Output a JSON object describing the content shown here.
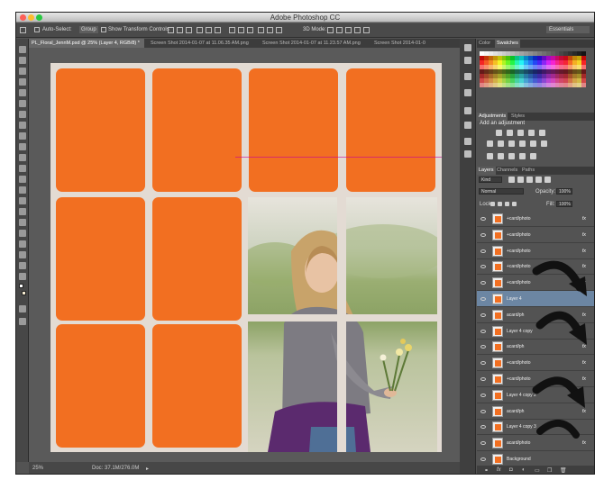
{
  "window": {
    "title": "Adobe Photoshop CC"
  },
  "options": {
    "auto_select_label": "Auto-Select:",
    "auto_select_value": "Group",
    "transform_label": "Show Transform Controls",
    "mode_label": "3D Mode:",
    "workspace": "Essentials"
  },
  "doc_tabs": [
    "PL_Floral_JennM.psd @ 25% (Layer 4, RGB/8) *",
    "Screen Shot 2014-01-07 at 11.06.35 AM.png",
    "Screen Shot 2014-01-07 at 11.23.57 AM.png",
    "Screen Shot 2014-01-0"
  ],
  "status": {
    "zoom": "25%",
    "doc": "Doc: 37.1M/276.0M"
  },
  "color_panel": {
    "tab_color": "Color",
    "tab_swatches": "Swatches"
  },
  "adjustments_panel": {
    "tab_adjustments": "Adjustments",
    "tab_styles": "Styles",
    "heading": "Add an adjustment"
  },
  "layers_panel": {
    "tab_layers": "Layers",
    "tab_channels": "Channels",
    "tab_paths": "Paths",
    "kind": "Kind",
    "blend_mode": "Normal",
    "opacity_label": "Opacity:",
    "opacity_value": "100%",
    "lock_label": "Lock:",
    "fill_label": "Fill:",
    "fill_value": "100%",
    "layers": [
      {
        "name": "+card/photo",
        "fx": "fx"
      },
      {
        "name": "+card/photo",
        "fx": "fx"
      },
      {
        "name": "+card/photo",
        "fx": "fx"
      },
      {
        "name": "+card/photo",
        "fx": "fx"
      },
      {
        "name": "+card/photo",
        "fx": "fx"
      },
      {
        "name": "Layer 4",
        "fx": ""
      },
      {
        "name": "acard/ph",
        "fx": "fx"
      },
      {
        "name": "Layer 4 copy",
        "fx": ""
      },
      {
        "name": "acard/ph",
        "fx": "fx"
      },
      {
        "name": "+card/photo",
        "fx": "fx"
      },
      {
        "name": "+card/photo",
        "fx": "fx"
      },
      {
        "name": "Layer 4 copy 2",
        "fx": ""
      },
      {
        "name": "acard/ph",
        "fx": "fx"
      },
      {
        "name": "Layer 4 copy 3",
        "fx": ""
      },
      {
        "name": "acard/photo",
        "fx": "fx"
      },
      {
        "name": "Background",
        "fx": ""
      }
    ]
  },
  "colors": {
    "accent_card": "#f26f21",
    "doc_bg": "#e3dbd3",
    "selected_layer": "#6c86a3"
  }
}
